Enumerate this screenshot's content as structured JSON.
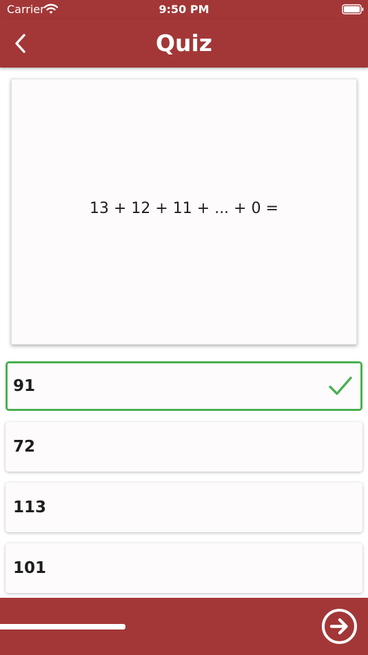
{
  "status_bar": {
    "carrier": "Carrier",
    "time": "9:50 PM",
    "wifi_icon": "wifi-icon",
    "battery_icon": "battery-full-icon"
  },
  "nav": {
    "title": "Quiz",
    "back_icon": "chevron-left-icon"
  },
  "question": {
    "text": "13 + 12 + 11 + ... + 0 ="
  },
  "options": [
    {
      "label": "91",
      "state": "correct",
      "icon": "check-icon"
    },
    {
      "label": "72",
      "state": "default"
    },
    {
      "label": "113",
      "state": "default"
    },
    {
      "label": "101",
      "state": "default"
    }
  ],
  "footer": {
    "progress": 0.34,
    "next_icon": "arrow-right-circle-icon"
  },
  "colors": {
    "brand": "#a33737",
    "correct": "#4caf50",
    "card_background": "#fefbfd",
    "text": "#1d1d1d"
  }
}
